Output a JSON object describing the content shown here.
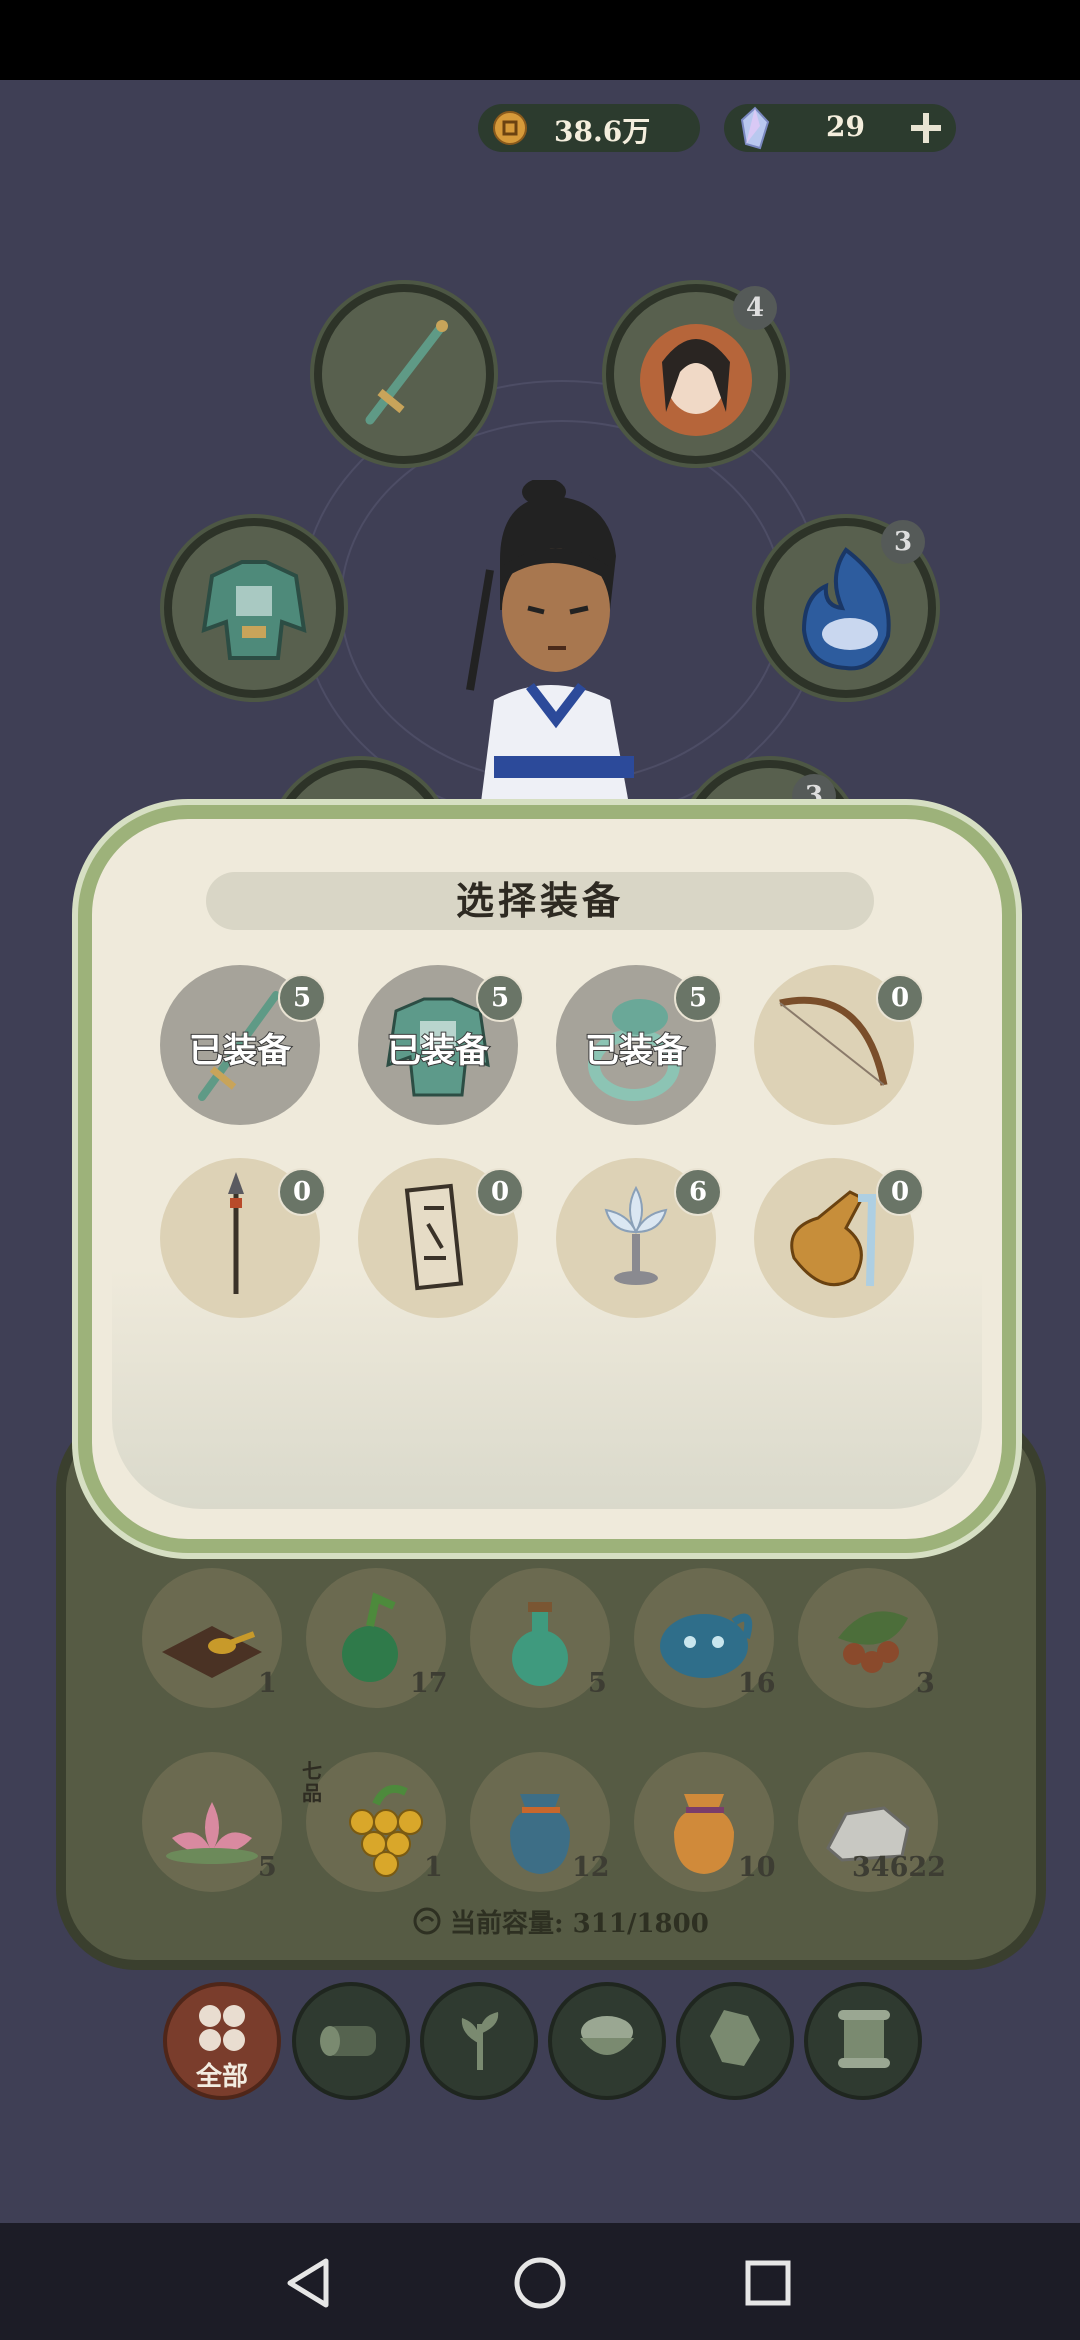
{
  "header": {
    "coins": "38.6万",
    "gems": "29",
    "coin_icon": "copper-coin-icon",
    "gem_icon": "spirit-crystal-icon",
    "add_icon": "plus-icon"
  },
  "character_slots": [
    {
      "name": "weapon-slot",
      "icon": "sword-icon",
      "badge": ""
    },
    {
      "name": "companion-slot",
      "icon": "companion-portrait-icon",
      "badge": "4"
    },
    {
      "name": "armor-slot",
      "icon": "armor-icon",
      "badge": ""
    },
    {
      "name": "spirit-beast-slot",
      "icon": "blue-flame-beast-icon",
      "badge": "3"
    },
    {
      "name": "lower-right-slot",
      "icon": "",
      "badge": "3"
    }
  ],
  "dialog": {
    "title": "选择装备",
    "items": [
      {
        "icon": "jade-sword-icon",
        "badge": "5",
        "label": "已装备"
      },
      {
        "icon": "jade-armor-icon",
        "badge": "5",
        "label": "已装备"
      },
      {
        "icon": "jade-ring-icon",
        "badge": "5",
        "label": "已装备"
      },
      {
        "icon": "bow-icon",
        "badge": "0",
        "label": ""
      },
      {
        "icon": "spear-icon",
        "badge": "0",
        "label": ""
      },
      {
        "icon": "talisman-scroll-icon",
        "badge": "0",
        "label": ""
      },
      {
        "icon": "lotus-lamp-icon",
        "badge": "6",
        "label": ""
      },
      {
        "icon": "gourd-vase-icon",
        "badge": "0",
        "label": ""
      }
    ]
  },
  "inventory": {
    "items": [
      {
        "icon": "ink-stone-icon",
        "count": "1"
      },
      {
        "icon": "green-gourd-icon",
        "count": "17"
      },
      {
        "icon": "green-potion-icon",
        "count": "5"
      },
      {
        "icon": "blue-beast-icon",
        "count": "16"
      },
      {
        "icon": "berries-icon",
        "count": "3"
      },
      {
        "icon": "pink-lotus-icon",
        "count": "5"
      },
      {
        "icon": "golden-grapes-icon",
        "count": "1",
        "tag": "七品"
      },
      {
        "icon": "blue-pouch-icon",
        "count": "12"
      },
      {
        "icon": "orange-pouch-icon",
        "count": "10"
      },
      {
        "icon": "stone-icon",
        "count": "34622"
      }
    ],
    "capacity_label": "当前容量:",
    "capacity_value": "311/1800"
  },
  "categories": [
    {
      "icon": "all-icon",
      "label": "全部",
      "active": true
    },
    {
      "icon": "wood-log-icon",
      "label": "",
      "active": false
    },
    {
      "icon": "herb-icon",
      "label": "",
      "active": false
    },
    {
      "icon": "rice-bowl-icon",
      "label": "",
      "active": false
    },
    {
      "icon": "ore-icon",
      "label": "",
      "active": false
    },
    {
      "icon": "scroll-icon",
      "label": "",
      "active": false
    }
  ],
  "system_nav": {
    "back_icon": "back-triangle-icon",
    "home_icon": "home-circle-icon",
    "recents_icon": "recents-square-icon"
  }
}
